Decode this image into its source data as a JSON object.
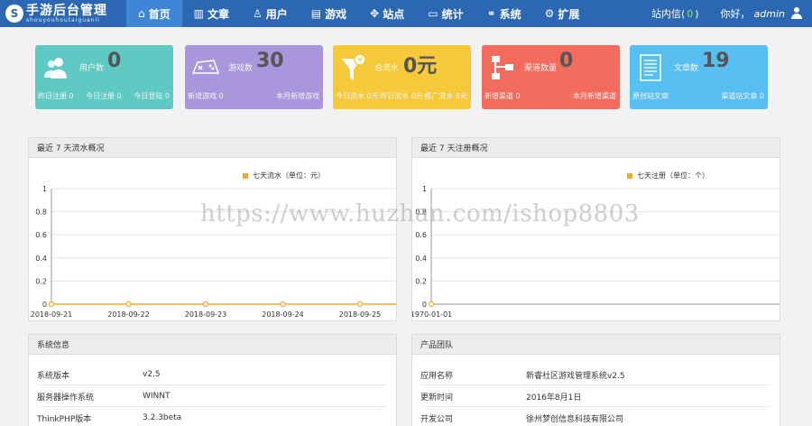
{
  "header": {
    "logo_title": "手游后台管理",
    "logo_sub": "shouyouhoutaiguanli",
    "nav": [
      {
        "label": "首页",
        "icon": "home-icon",
        "glyph": "⌂",
        "active": true
      },
      {
        "label": "文章",
        "icon": "bar-chart-icon",
        "glyph": "▥",
        "active": false
      },
      {
        "label": "用户",
        "icon": "user-group-icon",
        "glyph": "♙",
        "active": false
      },
      {
        "label": "游戏",
        "icon": "list-icon",
        "glyph": "▤",
        "active": false
      },
      {
        "label": "站点",
        "icon": "sitemap-icon",
        "glyph": "✥",
        "active": false
      },
      {
        "label": "统计",
        "icon": "monitor-icon",
        "glyph": "▭",
        "active": false
      },
      {
        "label": "系统",
        "icon": "link-icon",
        "glyph": "⚭",
        "active": false
      },
      {
        "label": "扩展",
        "icon": "gear-icon",
        "glyph": "⚙",
        "active": false
      }
    ],
    "inbox_label": "站内信",
    "inbox_count": "0",
    "greeting": "你好，",
    "username": "admin"
  },
  "cards": [
    {
      "label": "用户数",
      "value": "0",
      "color": "#5fc9c4",
      "icon": "users-icon",
      "foot": [
        "昨日注册 0",
        "今日注册 0",
        "今日登陆 0"
      ]
    },
    {
      "label": "游戏数",
      "value": "30",
      "color": "#a996dc",
      "icon": "gamepad-icon",
      "foot": [
        "新增游戏 0",
        "本月新增游戏"
      ]
    },
    {
      "label": "总流水",
      "value": "0元",
      "color": "#f6c93b",
      "icon": "funnel-icon",
      "foot": [
        "今日流水 0元",
        "昨日流水 0元",
        "推广流水 0元"
      ]
    },
    {
      "label": "渠道数量",
      "value": "0",
      "color": "#f26b5d",
      "icon": "sitemap-icon",
      "foot": [
        "新增渠道 0",
        "本月新增渠道"
      ]
    },
    {
      "label": "文章数",
      "value": "19",
      "color": "#58bff2",
      "icon": "document-icon",
      "foot": [
        "原创站文章",
        "渠道站文章 0"
      ]
    }
  ],
  "flow_panel": {
    "title": "最近 7 天流水概况",
    "legend": "七天流水（单位：元）",
    "chart_data": {
      "type": "line",
      "x": [
        "2018-09-21",
        "2018-09-22",
        "2018-09-23",
        "2018-09-24",
        "2018-09-25"
      ],
      "series": [
        {
          "name": "七天流水（单位：元）",
          "values": [
            0,
            0,
            0,
            0,
            0
          ]
        }
      ],
      "ylim": [
        0,
        1
      ],
      "yticks": [
        "0",
        "0.2",
        "0.4",
        "0.6",
        "0.8",
        "1"
      ],
      "color": "#f0a92e",
      "grid": true
    }
  },
  "reg_panel": {
    "title": "最近 7 天注册概况",
    "legend": "七天注册（单位：个）",
    "chart_data": {
      "type": "line",
      "x": [
        "1970-01-01"
      ],
      "series": [
        {
          "name": "七天注册（单位：个）",
          "values": [
            0
          ]
        }
      ],
      "ylim": [
        0,
        1
      ],
      "yticks": [
        "0",
        "0.2",
        "0.4",
        "0.6",
        "0.8",
        "1"
      ],
      "color": "#f0a92e",
      "grid": true
    }
  },
  "system_panel": {
    "title": "系统信息",
    "rows": [
      {
        "key": "系统版本",
        "value": "v2.5"
      },
      {
        "key": "服务器操作系统",
        "value": "WINNT"
      },
      {
        "key": "ThinkPHP版本",
        "value": "3.2.3beta"
      }
    ]
  },
  "team_panel": {
    "title": "产品团队",
    "rows": [
      {
        "key": "应用名称",
        "value": "新睿社区游戏管理系统v2.5"
      },
      {
        "key": "更新时间",
        "value": "2016年8月1日"
      },
      {
        "key": "开发公司",
        "value": "徐州梦创信息科技有限公司"
      }
    ]
  },
  "watermark": "https://www.huzhan.com/ishop8803"
}
